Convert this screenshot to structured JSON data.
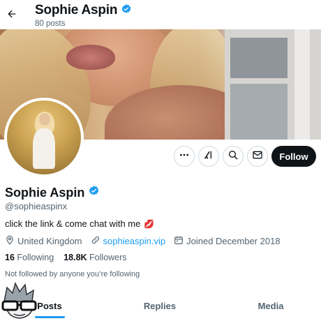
{
  "header": {
    "back_icon": "arrow-left-icon",
    "title": "Sophie Aspin",
    "posts_count": "80 posts",
    "verified_color": "#1d9bf0"
  },
  "actions": {
    "more_icon": "more-dots-icon",
    "grok_icon": "grok-icon",
    "search_icon": "search-icon",
    "message_icon": "mail-icon",
    "follow_label": "Follow"
  },
  "profile": {
    "name": "Sophie Aspin",
    "handle": "@sophieaspinx",
    "bio": "click the link & come chat with me",
    "bio_emoji": "💋",
    "location": "United Kingdom",
    "website": "sophieaspin.vip",
    "joined": "Joined December 2018",
    "following_count": "16",
    "following_label": "Following",
    "followers_count": "18.8K",
    "followers_label": "Followers",
    "not_followed": "Not followed by anyone you’re following"
  },
  "tabs": [
    {
      "label": "Posts",
      "active": true
    },
    {
      "label": "Replies",
      "active": false
    },
    {
      "label": "Media",
      "active": false
    }
  ],
  "colors": {
    "accent": "#1d9bf0",
    "text": "#0f1419",
    "secondary": "#536471"
  }
}
